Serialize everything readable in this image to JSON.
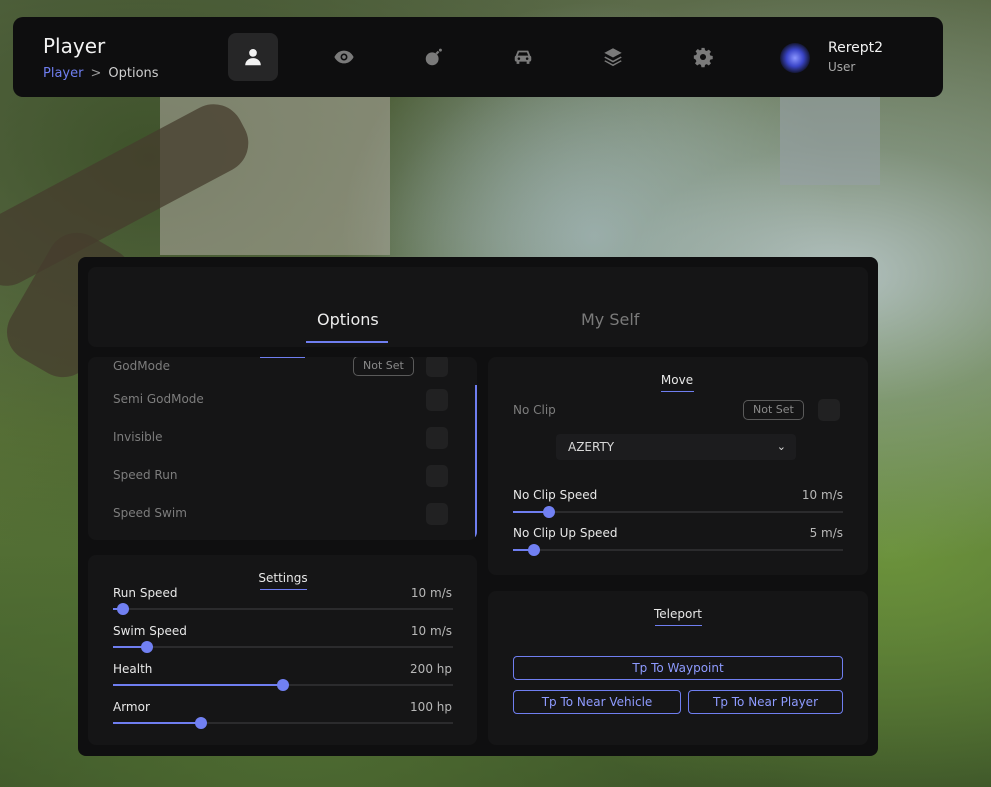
{
  "header": {
    "title": "Player",
    "breadcrumb": [
      "Player",
      ">",
      "Options"
    ],
    "nav_icons": [
      "user-icon",
      "eye-icon",
      "bomb-icon",
      "car-icon",
      "layers-icon",
      "gear-icon"
    ],
    "active_nav": "user-icon",
    "user": {
      "name": "Rerept2",
      "role": "User"
    }
  },
  "tabs": [
    {
      "label": "Options",
      "active": true
    },
    {
      "label": "My Self",
      "active": false
    }
  ],
  "godmode_panel": {
    "items": [
      {
        "label": "GodMode",
        "badge": "Not Set",
        "checked": false
      },
      {
        "label": "Semi GodMode",
        "checked": false
      },
      {
        "label": "Invisible",
        "checked": false
      },
      {
        "label": "Speed Run",
        "checked": false
      },
      {
        "label": "Speed Swim",
        "checked": false
      }
    ]
  },
  "settings_panel": {
    "title": "Settings",
    "sliders": [
      {
        "label": "Run Speed",
        "value_text": "10 m/s",
        "fraction": 0.03
      },
      {
        "label": "Swim Speed",
        "value_text": "10 m/s",
        "fraction": 0.1
      },
      {
        "label": "Health",
        "value_text": "200 hp",
        "fraction": 0.5
      },
      {
        "label": "Armor",
        "value_text": "100 hp",
        "fraction": 0.26
      }
    ]
  },
  "move_panel": {
    "title": "Move",
    "noclip": {
      "label": "No Clip",
      "badge": "Not Set",
      "checked": false
    },
    "layout_select": {
      "value": "AZERTY"
    },
    "sliders": [
      {
        "label": "No Clip Speed",
        "value_text": "10 m/s",
        "fraction": 0.11
      },
      {
        "label": "No Clip Up Speed",
        "value_text": "5 m/s",
        "fraction": 0.065
      }
    ]
  },
  "teleport_panel": {
    "title": "Teleport",
    "buttons": [
      "Tp To Waypoint",
      "Tp To Near Vehicle",
      "Tp To Near Player"
    ]
  },
  "colors": {
    "accent": "#6f7ef0",
    "panel": "#0f0f10",
    "card": "#151516"
  }
}
